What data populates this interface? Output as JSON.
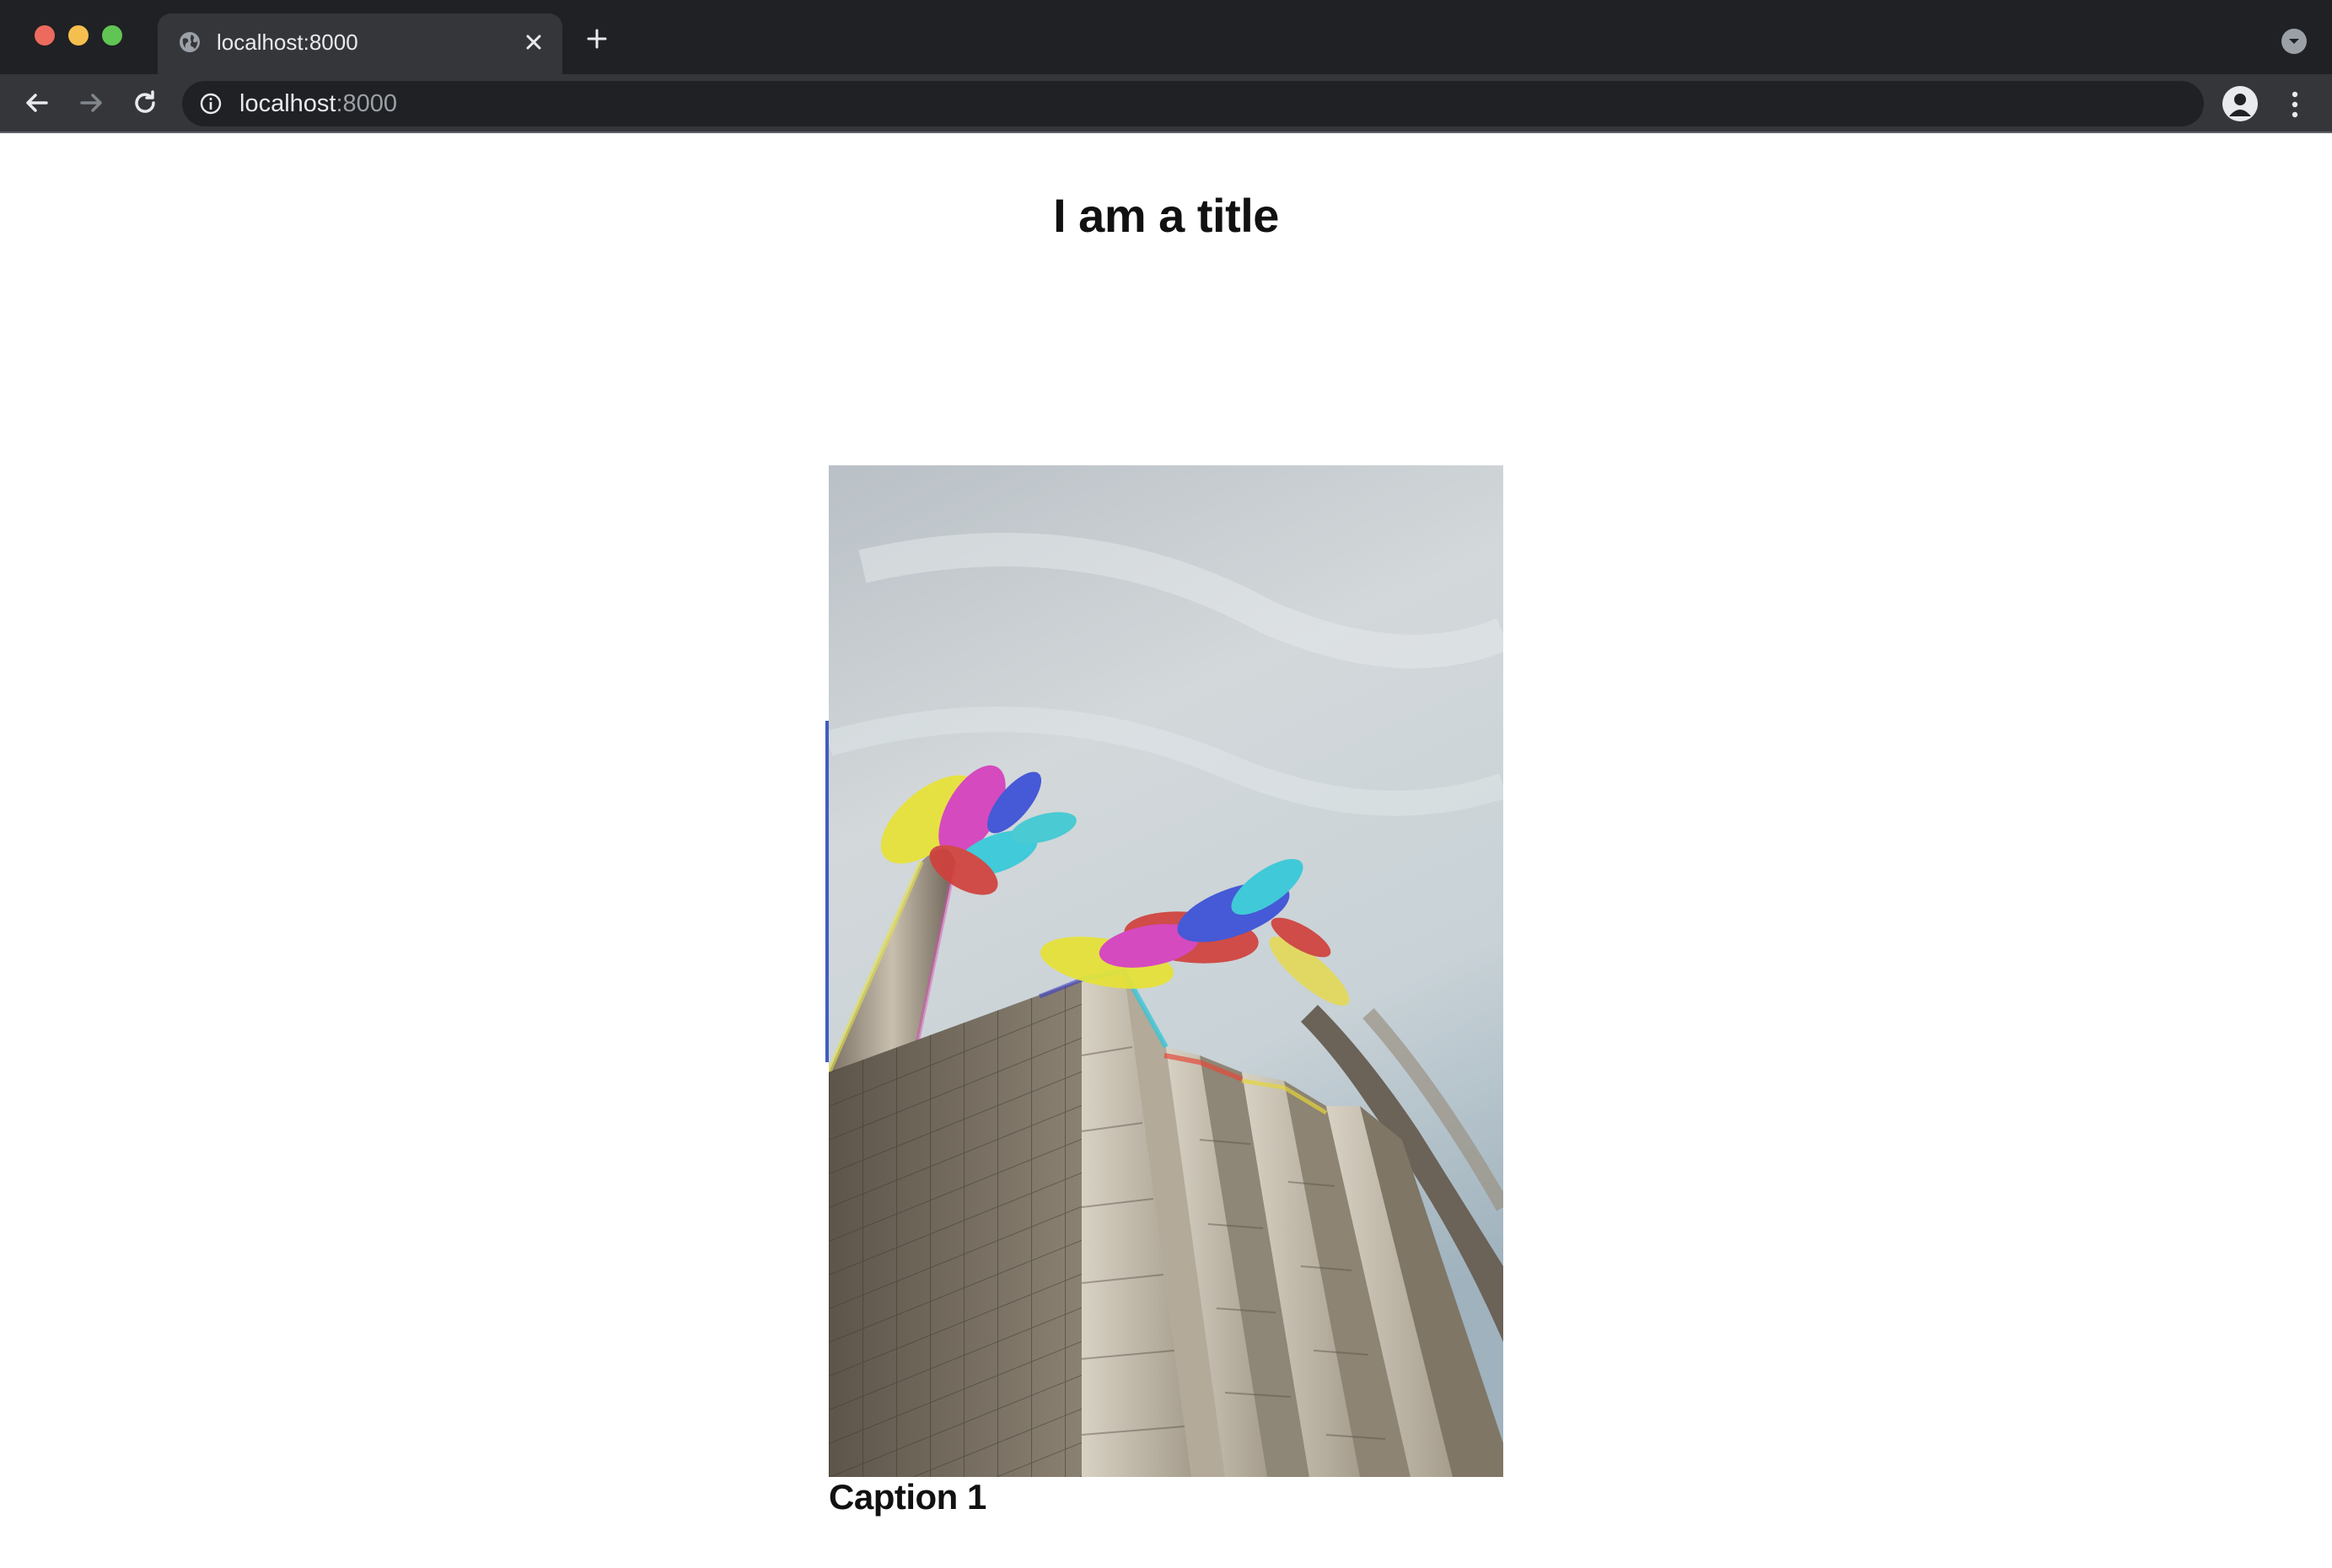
{
  "browser": {
    "tab": {
      "title": "localhost:8000",
      "favicon": "globe-icon"
    },
    "address_bar": {
      "host": "localhost",
      "port": ":8000"
    },
    "icons": [
      "back-arrow-icon",
      "forward-arrow-icon",
      "reload-icon",
      "info-icon",
      "bookmark-star-icon",
      "profile-icon",
      "kebab-menu-icon",
      "new-tab-plus-icon",
      "tab-search-icon",
      "close-icon"
    ],
    "window_controls": {
      "close": "#ed6a5e",
      "minimize": "#f5bf4f",
      "maximize": "#61c554"
    }
  },
  "page": {
    "title": "I am a title",
    "figure": {
      "caption": "Caption 1"
    }
  },
  "colors": {
    "chrome_dark": "#202124",
    "chrome_tab": "#35363a",
    "page_background": "#ffffff",
    "text": "#111111"
  }
}
